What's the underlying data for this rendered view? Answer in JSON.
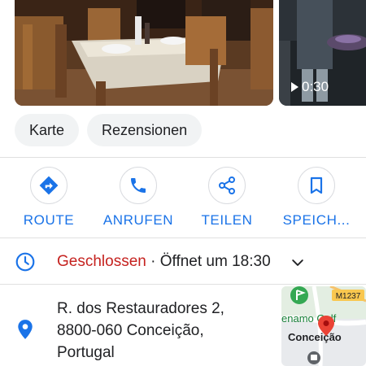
{
  "photos": {
    "video_duration": "0:30",
    "items": [
      {
        "type": "photo",
        "subject": "restaurant interior with tables and chairs"
      },
      {
        "type": "video"
      }
    ]
  },
  "chips": [
    {
      "label": "Karte"
    },
    {
      "label": "Rezensionen"
    }
  ],
  "actions": [
    {
      "label": "ROUTE",
      "icon": "directions-icon"
    },
    {
      "label": "ANRUFEN",
      "icon": "phone-icon"
    },
    {
      "label": "TEILEN",
      "icon": "share-icon"
    },
    {
      "label": "SPEICH...",
      "icon": "bookmark-icon"
    }
  ],
  "hours": {
    "status": "Geschlossen",
    "separator": " · ",
    "next": "Öffnet um 18:30"
  },
  "address": {
    "line1": "R. dos Restauradores 2,",
    "line2": "8800-060 Conceição,",
    "line3": "Portugal"
  },
  "map": {
    "road_label": "M1237",
    "poi_label": "enamo Golf",
    "place_label": "Conceição"
  },
  "colors": {
    "accent": "#1a73e8",
    "closed": "#c5221f",
    "chip_bg": "#f1f3f4",
    "pin": "#ea4335"
  }
}
